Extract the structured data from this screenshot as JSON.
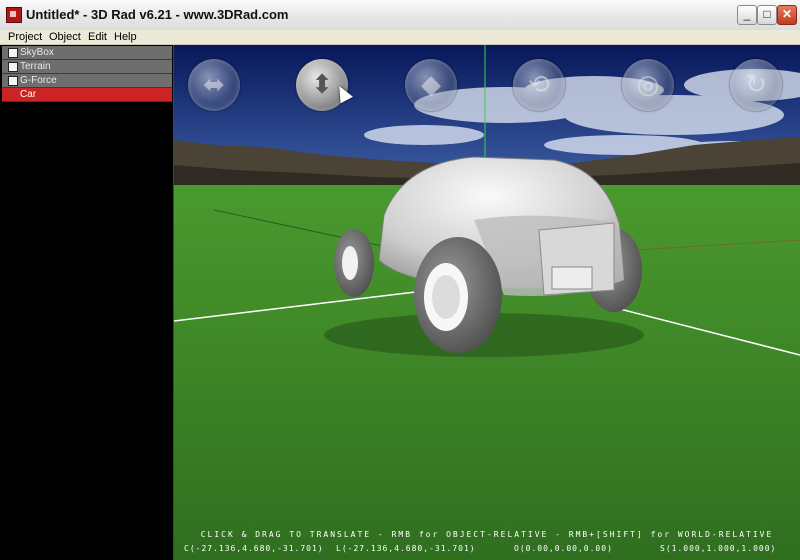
{
  "window": {
    "title": "Untitled* - 3D Rad v6.21 - www.3DRad.com",
    "controls": {
      "minimize": "_",
      "maximize": "□",
      "close": "✕"
    }
  },
  "menu": [
    "Project",
    "Object",
    "Edit",
    "Help"
  ],
  "objects": [
    {
      "label": "SkyBox",
      "checked": false,
      "selected": false
    },
    {
      "label": "Terrain",
      "checked": false,
      "selected": false
    },
    {
      "label": "G-Force",
      "checked": false,
      "selected": false
    },
    {
      "label": "Car",
      "checked": false,
      "selected": true
    }
  ],
  "toolbar": {
    "buttons": [
      {
        "name": "move-horizontal",
        "icon": "horizontal-arrow-icon",
        "glyph": "⬌",
        "active": false
      },
      {
        "name": "move-vertical",
        "icon": "vertical-arrow-icon",
        "glyph": "⬍",
        "active": true
      },
      {
        "name": "move-depth",
        "icon": "depth-arrow-icon",
        "glyph": "◆",
        "active": false
      },
      {
        "name": "rotate-x",
        "icon": "rotate-icon",
        "glyph": "⟲",
        "active": false
      },
      {
        "name": "rotate-y",
        "icon": "rotate-icon",
        "glyph": "◎",
        "active": false
      },
      {
        "name": "rotate-z",
        "icon": "rotate-icon",
        "glyph": "↻",
        "active": false
      }
    ]
  },
  "status": {
    "hint": "CLICK & DRAG TO TRANSLATE - RMB for OBJECT-RELATIVE - RMB+[SHIFT] for WORLD-RELATIVE",
    "c": "C(-27.136,4.680,-31.701)",
    "l": "L(-27.136,4.680,-31.701)",
    "o": "O(0.00,0.00,0.00)",
    "s": "S(1.000,1.000,1.000)"
  },
  "colors": {
    "selected_row": "#cc2424",
    "sky": "#0c2266",
    "grass": "#3f8f2c",
    "axis_line": "#39d24a"
  }
}
